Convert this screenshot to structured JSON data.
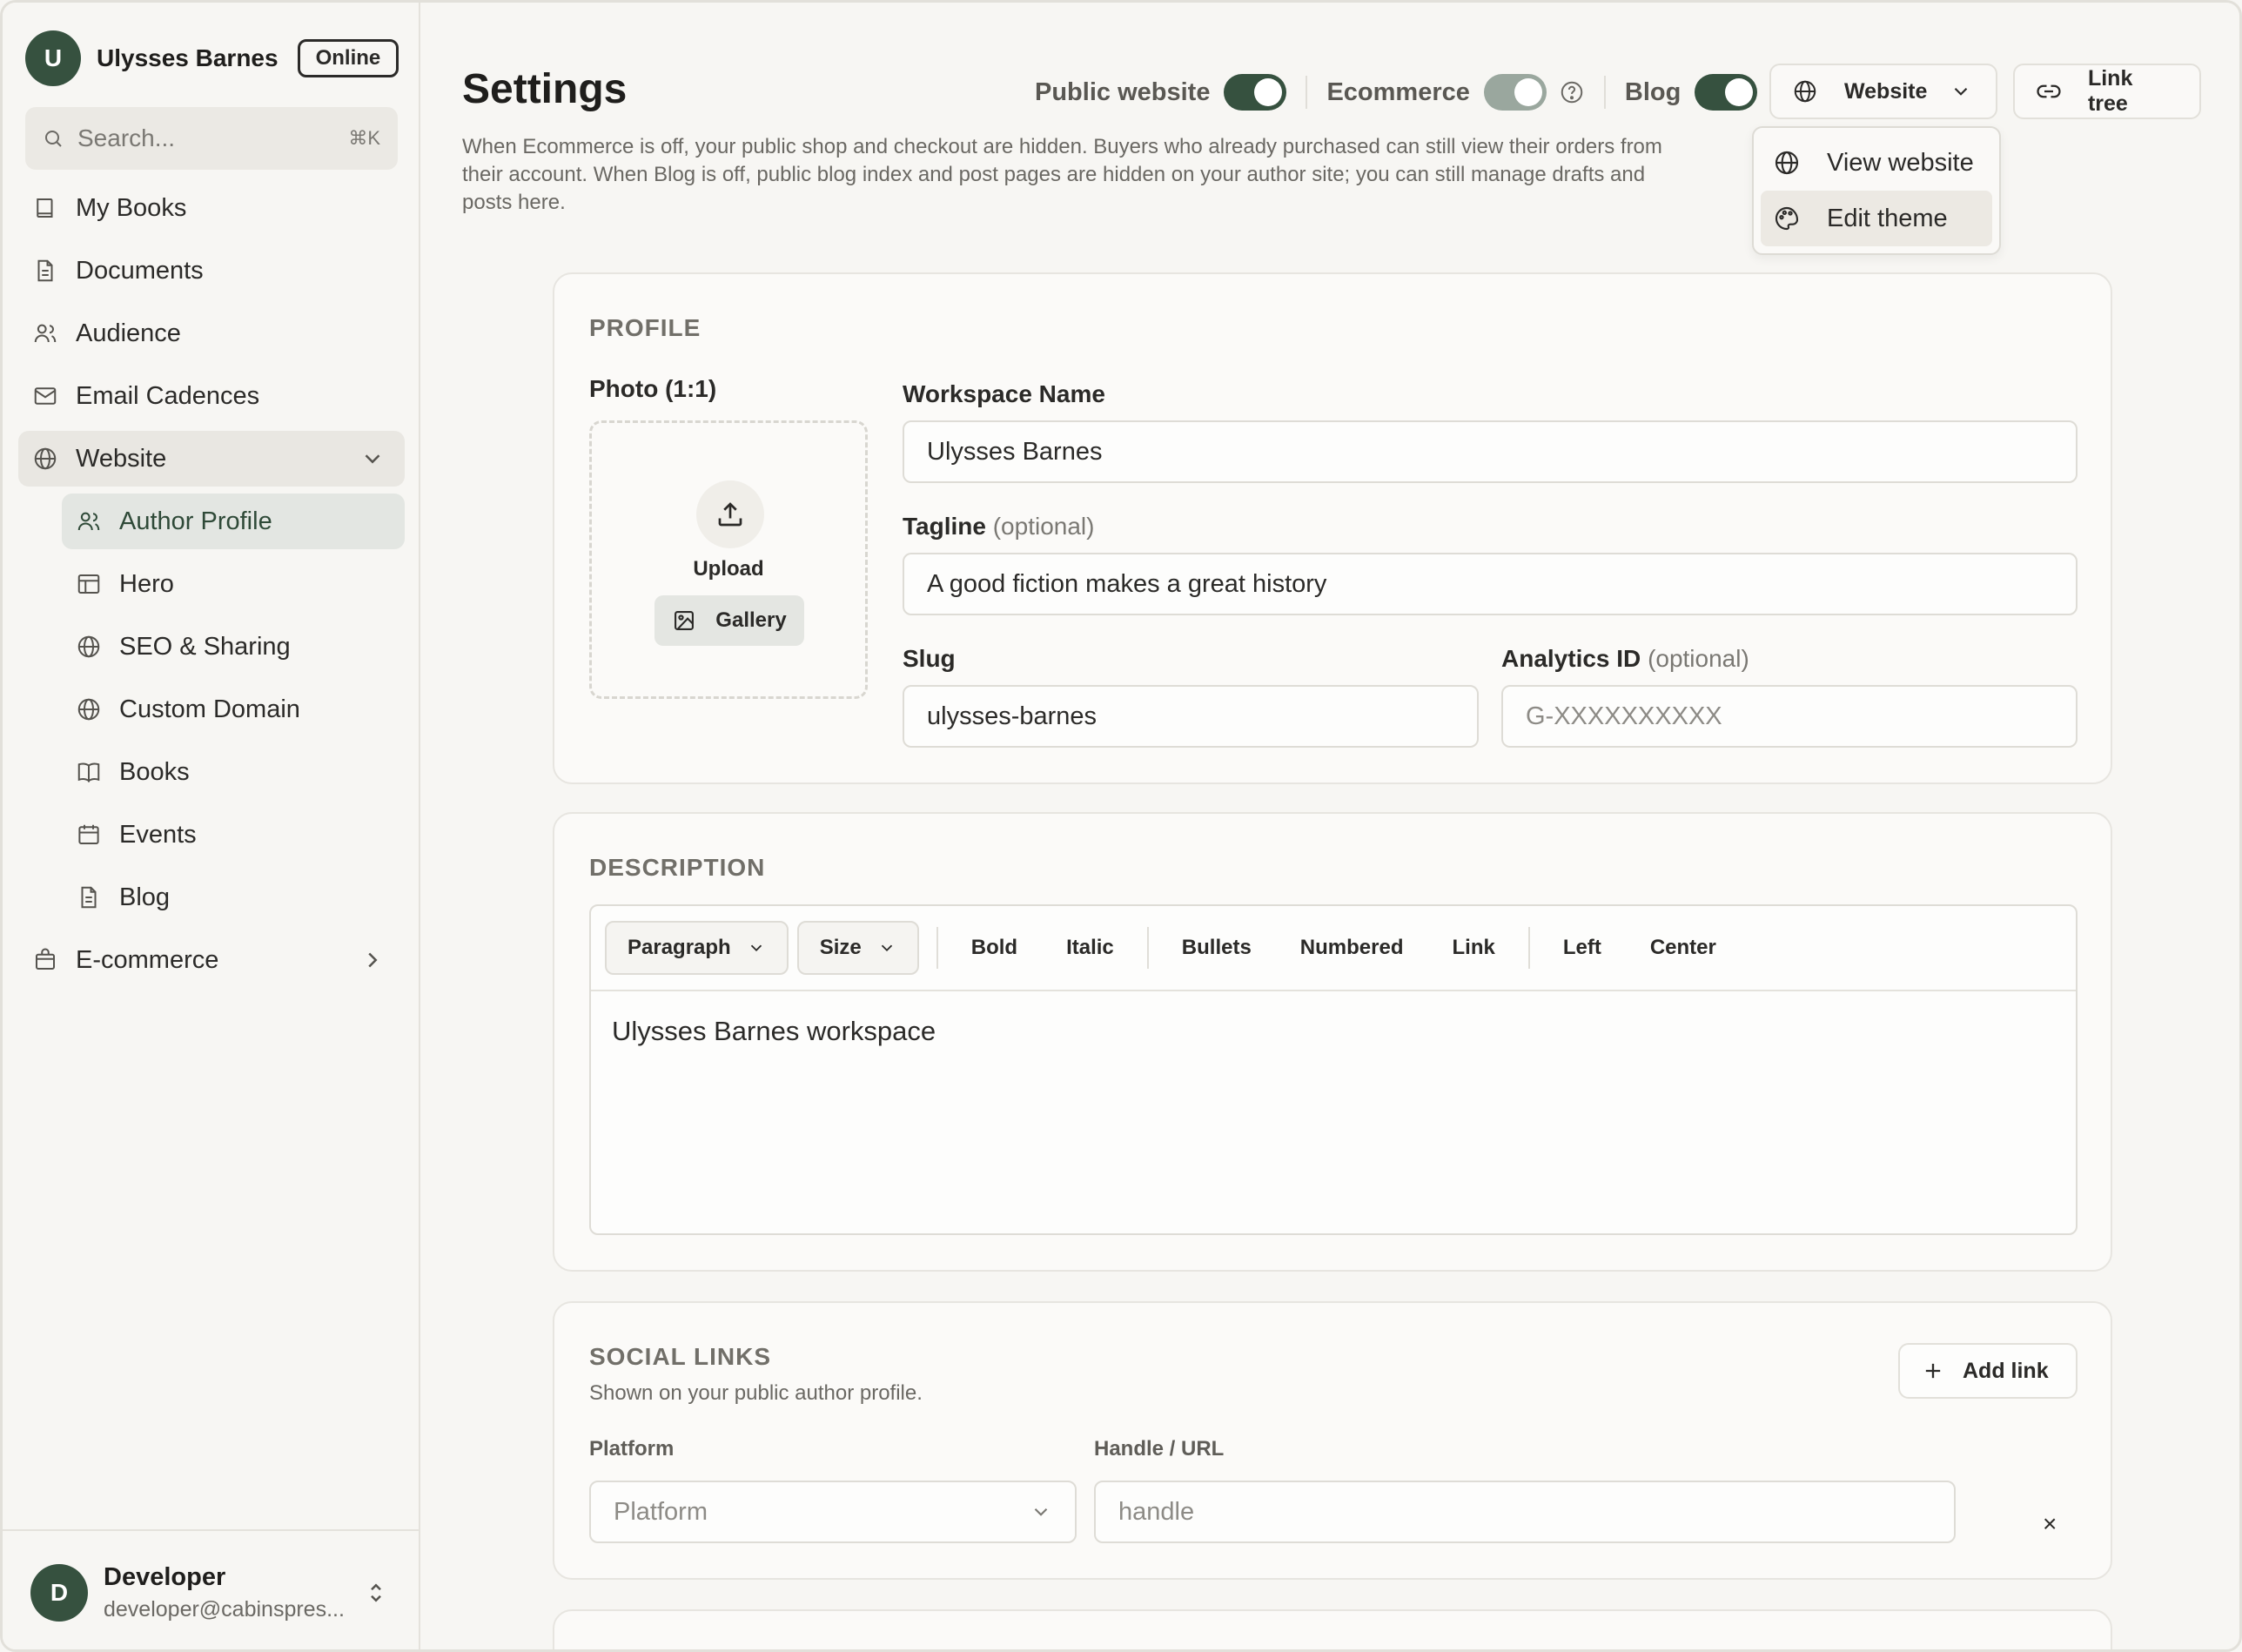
{
  "sidebar": {
    "user": {
      "initial": "U",
      "name": "Ulysses Barnes",
      "status": "Online"
    },
    "search": {
      "placeholder": "Search...",
      "shortcut": "⌘K"
    },
    "items": [
      {
        "label": "My Books",
        "icon": "book-icon"
      },
      {
        "label": "Documents",
        "icon": "document-icon"
      },
      {
        "label": "Audience",
        "icon": "users-icon"
      },
      {
        "label": "Email Cadences",
        "icon": "mail-icon"
      },
      {
        "label": "Website",
        "icon": "globe-icon",
        "expanded": true
      },
      {
        "label": "E-commerce",
        "icon": "shopping-bag-icon"
      }
    ],
    "website_sub": [
      {
        "label": "Author Profile",
        "icon": "users-icon",
        "active": true
      },
      {
        "label": "Hero",
        "icon": "layout-icon"
      },
      {
        "label": "SEO & Sharing",
        "icon": "globe-icon"
      },
      {
        "label": "Custom Domain",
        "icon": "globe-icon"
      },
      {
        "label": "Books",
        "icon": "open-book-icon"
      },
      {
        "label": "Events",
        "icon": "calendar-icon"
      },
      {
        "label": "Blog",
        "icon": "document-icon"
      }
    ],
    "footer": {
      "initial": "D",
      "name": "Developer",
      "email": "developer@cabinspres..."
    }
  },
  "header": {
    "title": "Settings",
    "description": "When Ecommerce is off, your public shop and checkout are hidden. Buyers who already purchased can still view their orders from their account. When Blog is off, public blog index and post pages are hidden on your author site; you can still manage drafts and posts here.",
    "toggles": [
      {
        "label": "Public website",
        "on": true
      },
      {
        "label": "Ecommerce",
        "on": true,
        "disabled": true
      },
      {
        "label": "Blog",
        "on": true
      }
    ],
    "website_button": "Website",
    "link_tree_button": "Link tree"
  },
  "website_menu": {
    "items": [
      {
        "label": "View website",
        "icon": "globe-icon"
      },
      {
        "label": "Edit theme",
        "icon": "palette-icon",
        "highlighted": true
      }
    ]
  },
  "profile": {
    "section_title": "PROFILE",
    "photo_label": "Photo (1:1)",
    "upload_label": "Upload",
    "gallery_label": "Gallery",
    "workspace_name_label": "Workspace Name",
    "workspace_name_value": "Ulysses Barnes",
    "tagline_label": "Tagline",
    "tagline_optional": "(optional)",
    "tagline_value": "A good fiction makes a great history",
    "slug_label": "Slug",
    "slug_value": "ulysses-barnes",
    "analytics_label": "Analytics ID",
    "analytics_optional": "(optional)",
    "analytics_placeholder": "G-XXXXXXXXXX"
  },
  "description": {
    "section_title": "DESCRIPTION",
    "toolbar": {
      "paragraph": "Paragraph",
      "size": "Size",
      "bold": "Bold",
      "italic": "Italic",
      "bullets": "Bullets",
      "numbered": "Numbered",
      "link": "Link",
      "left": "Left",
      "center": "Center"
    },
    "content": "Ulysses Barnes workspace"
  },
  "social": {
    "section_title": "SOCIAL LINKS",
    "subtitle": "Shown on your public author profile.",
    "add_link": "Add link",
    "platform_label": "Platform",
    "handle_label": "Handle / URL",
    "platform_placeholder": "Platform",
    "handle_placeholder": "handle",
    "remove": "×"
  },
  "colors": {
    "accent": "#36513f",
    "background": "#f7f6f3",
    "card": "#fbfaf8"
  }
}
